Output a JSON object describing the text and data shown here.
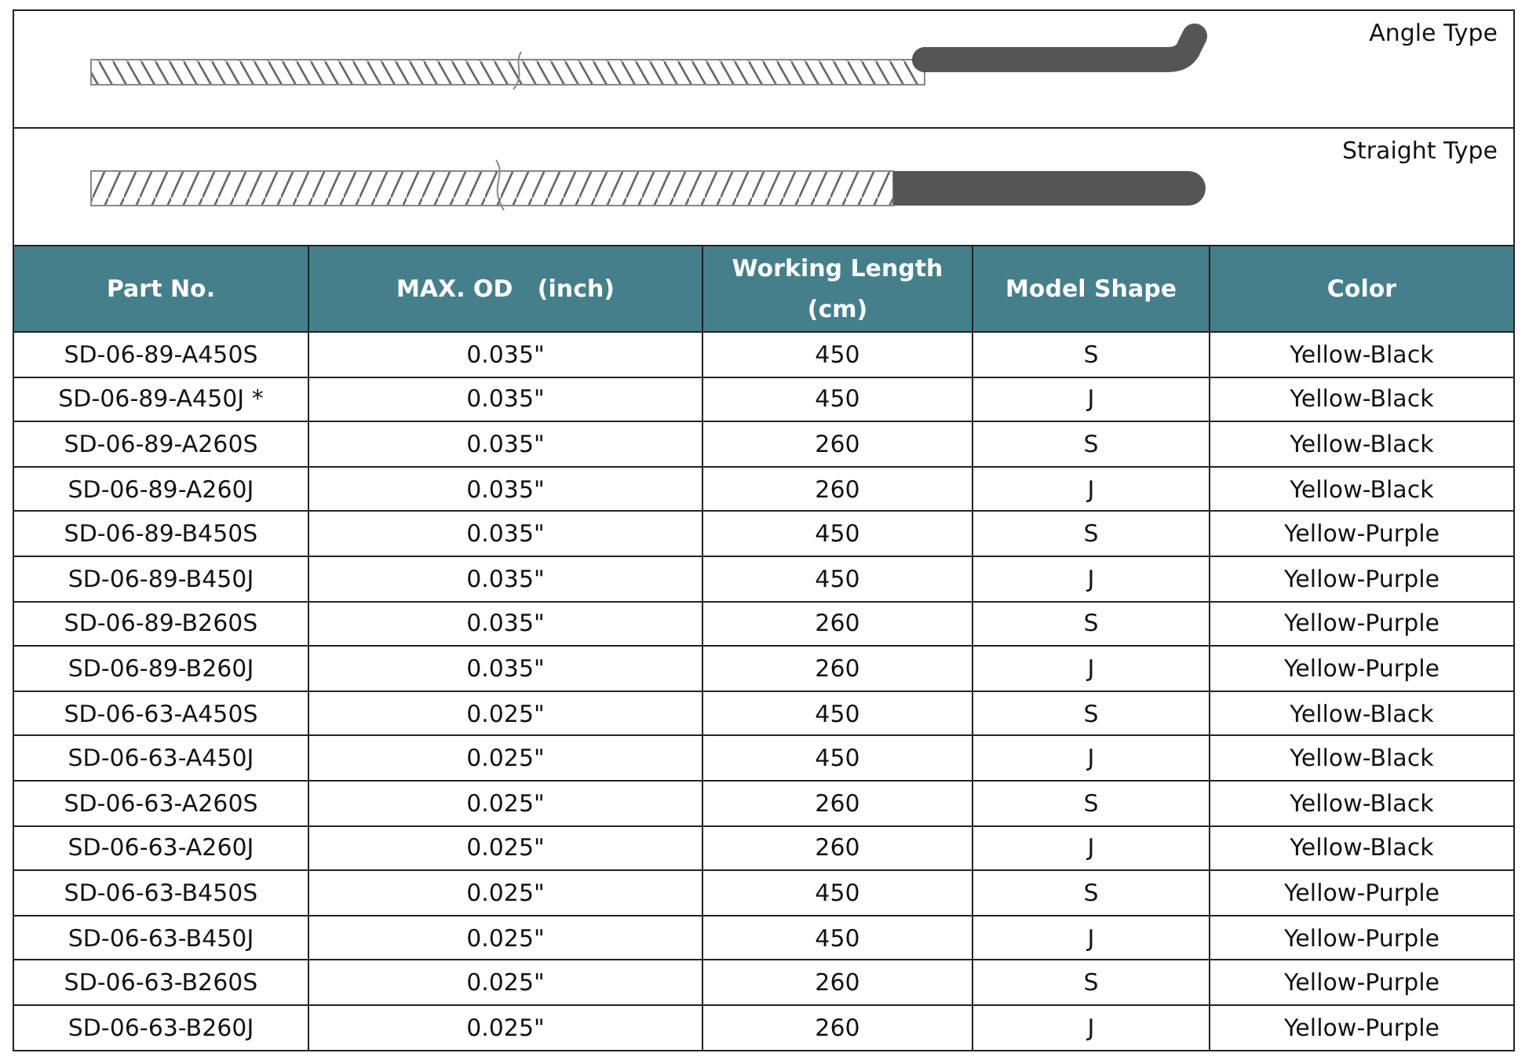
{
  "types": [
    {
      "kind": "angle",
      "label": "Angle Type"
    },
    {
      "kind": "straight",
      "label": "Straight Type"
    }
  ],
  "table": {
    "columns": [
      "Part No.",
      "MAX. OD   (inch)",
      "Working Length (cm)",
      "Model Shape",
      "Color"
    ],
    "rows": [
      [
        "SD-06-89-A450S",
        "0.035\"",
        "450",
        "S",
        "Yellow-Black"
      ],
      [
        "SD-06-89-A450J *",
        "0.035\"",
        "450",
        "J",
        "Yellow-Black"
      ],
      [
        "SD-06-89-A260S",
        "0.035\"",
        "260",
        "S",
        "Yellow-Black"
      ],
      [
        "SD-06-89-A260J",
        "0.035\"",
        "260",
        "J",
        "Yellow-Black"
      ],
      [
        "SD-06-89-B450S",
        "0.035\"",
        "450",
        "S",
        "Yellow-Purple"
      ],
      [
        "SD-06-89-B450J",
        "0.035\"",
        "450",
        "J",
        "Yellow-Purple"
      ],
      [
        "SD-06-89-B260S",
        "0.035\"",
        "260",
        "S",
        "Yellow-Purple"
      ],
      [
        "SD-06-89-B260J",
        "0.035\"",
        "260",
        "J",
        "Yellow-Purple"
      ],
      [
        "SD-06-63-A450S",
        "0.025\"",
        "450",
        "S",
        "Yellow-Black"
      ],
      [
        "SD-06-63-A450J",
        "0.025\"",
        "450",
        "J",
        "Yellow-Black"
      ],
      [
        "SD-06-63-A260S",
        "0.025\"",
        "260",
        "S",
        "Yellow-Black"
      ],
      [
        "SD-06-63-A260J",
        "0.025\"",
        "260",
        "J",
        "Yellow-Black"
      ],
      [
        "SD-06-63-B450S",
        "0.025\"",
        "450",
        "S",
        "Yellow-Purple"
      ],
      [
        "SD-06-63-B450J",
        "0.025\"",
        "450",
        "J",
        "Yellow-Purple"
      ],
      [
        "SD-06-63-B260S",
        "0.025\"",
        "260",
        "S",
        "Yellow-Purple"
      ],
      [
        "SD-06-63-B260J",
        "0.025\"",
        "260",
        "J",
        "Yellow-Purple"
      ]
    ]
  }
}
